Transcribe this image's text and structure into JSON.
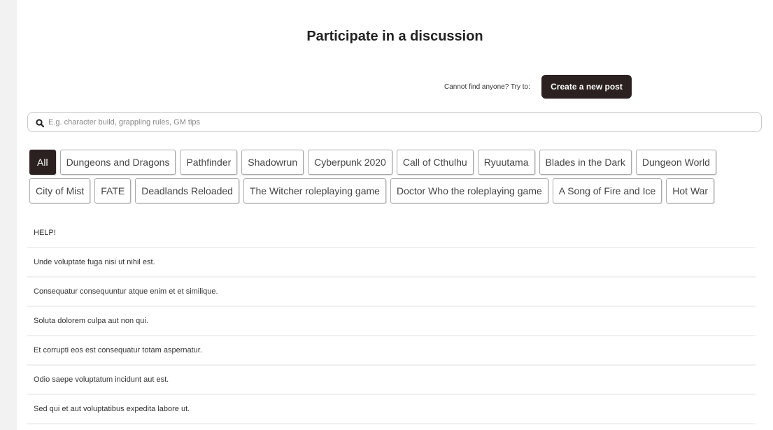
{
  "page": {
    "title": "Participate in a discussion"
  },
  "cta": {
    "text": "Cannot find anyone? Try to:",
    "button_label": "Create a new post"
  },
  "search": {
    "placeholder": "E.g. character build, grappling rules, GM tips",
    "value": ""
  },
  "filters": {
    "active": "All",
    "row1": [
      "All",
      "Dungeons and Dragons",
      "Pathfinder",
      "Shadowrun",
      "Cyberpunk 2020",
      "Call of Cthulhu",
      "Ryuutama",
      "Blades in the Dark",
      "Dungeon World"
    ],
    "row2": [
      "City of Mist",
      "FATE",
      "Deadlands Reloaded",
      "The Witcher roleplaying game",
      "Doctor Who the roleplaying game",
      "A Song of Fire and Ice",
      "Hot War"
    ]
  },
  "posts": [
    "HELP!",
    "Unde voluptate fuga nisi ut nihil est.",
    "Consequatur consequuntur atque enim et et similique.",
    "Soluta dolorem culpa aut non qui.",
    "Et corrupti eos est consequatur totam aspernatur.",
    "Odio saepe voluptatum incidunt aut est.",
    "Sed qui et aut voluptatibus expedita labore ut."
  ],
  "colors": {
    "accent": "#2b2120",
    "border": "#a9a9a9",
    "gutter": "#f2f2f2"
  },
  "icons": {
    "search": "search-icon"
  }
}
